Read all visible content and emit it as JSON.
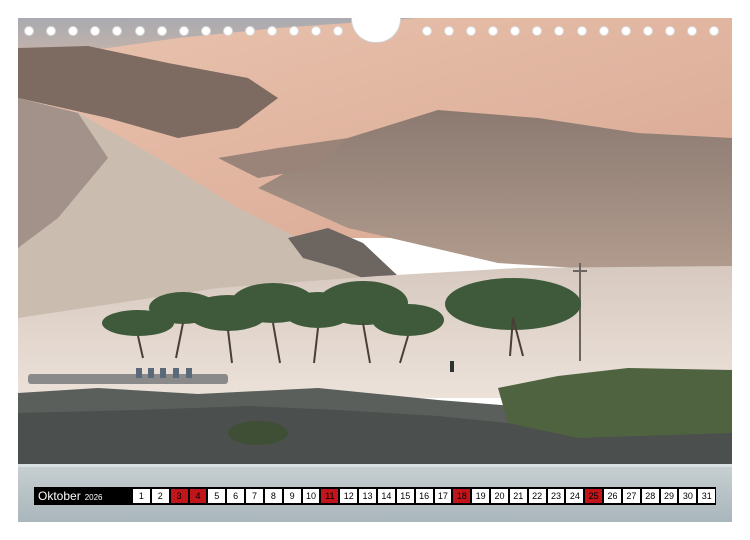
{
  "calendar": {
    "month": "Oktober",
    "year": "2026",
    "days": [
      {
        "label": "1",
        "highlight": false
      },
      {
        "label": "2",
        "highlight": false
      },
      {
        "label": "3",
        "highlight": true
      },
      {
        "label": "4",
        "highlight": true
      },
      {
        "label": "5",
        "highlight": false
      },
      {
        "label": "6",
        "highlight": false
      },
      {
        "label": "7",
        "highlight": false
      },
      {
        "label": "8",
        "highlight": false
      },
      {
        "label": "9",
        "highlight": false
      },
      {
        "label": "10",
        "highlight": false
      },
      {
        "label": "11",
        "highlight": true
      },
      {
        "label": "12",
        "highlight": false
      },
      {
        "label": "13",
        "highlight": false
      },
      {
        "label": "14",
        "highlight": false
      },
      {
        "label": "15",
        "highlight": false
      },
      {
        "label": "16",
        "highlight": false
      },
      {
        "label": "17",
        "highlight": false
      },
      {
        "label": "18",
        "highlight": true
      },
      {
        "label": "19",
        "highlight": false
      },
      {
        "label": "20",
        "highlight": false
      },
      {
        "label": "21",
        "highlight": false
      },
      {
        "label": "22",
        "highlight": false
      },
      {
        "label": "23",
        "highlight": false
      },
      {
        "label": "24",
        "highlight": false
      },
      {
        "label": "25",
        "highlight": true
      },
      {
        "label": "26",
        "highlight": false
      },
      {
        "label": "27",
        "highlight": false
      },
      {
        "label": "28",
        "highlight": false
      },
      {
        "label": "29",
        "highlight": false
      },
      {
        "label": "30",
        "highlight": false
      },
      {
        "label": "31",
        "highlight": false
      }
    ],
    "colors": {
      "bar": "#000000",
      "day": "#ffffff",
      "highlight": "#c0151b"
    }
  },
  "photo": {
    "subject": "desert-dunes-with-acacia-trees-by-river",
    "colors": {
      "sky": "#c9b8aa",
      "dune_light": "#e8c2ad",
      "dune_shadow": "#7a6a62",
      "trees": "#3f5a3a",
      "rocks": "#4f5452",
      "water": "#b9c4c8"
    }
  }
}
